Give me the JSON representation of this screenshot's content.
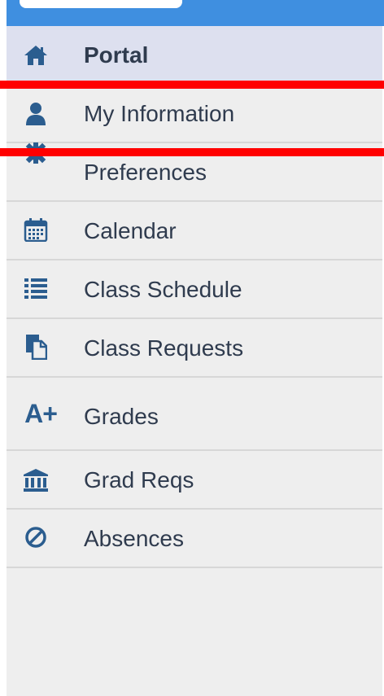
{
  "sidebar": {
    "items": [
      {
        "label": "Portal",
        "icon": "home-icon",
        "active": true
      },
      {
        "label": "My Information",
        "icon": "user-icon",
        "active": false
      },
      {
        "label": "Preferences",
        "icon": "gear-icon",
        "active": false
      },
      {
        "label": "Calendar",
        "icon": "calendar-icon",
        "active": false
      },
      {
        "label": "Class Schedule",
        "icon": "list-icon",
        "active": false
      },
      {
        "label": "Class Requests",
        "icon": "documents-icon",
        "active": false
      },
      {
        "label": "Grades",
        "icon": "a-plus-icon",
        "icon_text": "A+",
        "active": false
      },
      {
        "label": "Grad Reqs",
        "icon": "institution-icon",
        "active": false
      },
      {
        "label": "Absences",
        "icon": "ban-icon",
        "active": false
      }
    ]
  },
  "colors": {
    "header": "#3f8fe0",
    "sidebar_bg": "#eeeeee",
    "active_bg": "#dde0ef",
    "icon": "#2b5d8f",
    "text": "#2f3b4e",
    "highlight": "#ff0000"
  }
}
